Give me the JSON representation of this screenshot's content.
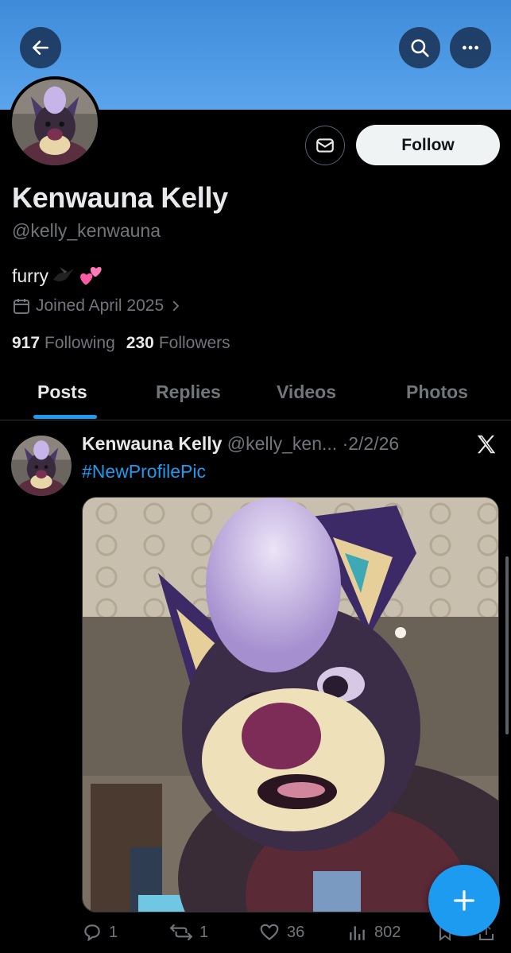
{
  "profile": {
    "name": "Kenwauna Kelly",
    "handle": "@kelly_kenwauna",
    "bio_text": "furry",
    "bio_emojis": [
      "black-bird-emoji",
      "two-hearts-emoji"
    ],
    "joined": "Joined April 2025",
    "following_count": "917",
    "following_label": "Following",
    "followers_count": "230",
    "followers_label": "Followers"
  },
  "header": {
    "follow_label": "Follow",
    "icons": [
      "back-arrow-icon",
      "search-icon",
      "more-icon",
      "message-icon"
    ]
  },
  "tabs": [
    {
      "label": "Posts",
      "active": true
    },
    {
      "label": "Replies",
      "active": false
    },
    {
      "label": "Videos",
      "active": false
    },
    {
      "label": "Photos",
      "active": false
    }
  ],
  "post": {
    "author": "Kenwauna Kelly",
    "handle": "@kelly_ken...",
    "separator": "·",
    "date": "2/2/26",
    "hashtag": "#NewProfilePic",
    "replies": "1",
    "reposts": "1",
    "likes": "36",
    "views": "802"
  },
  "colors": {
    "accent": "#1d9bf0",
    "banner": "#4a97e3",
    "background": "#000000",
    "muted_text": "#71767b"
  }
}
